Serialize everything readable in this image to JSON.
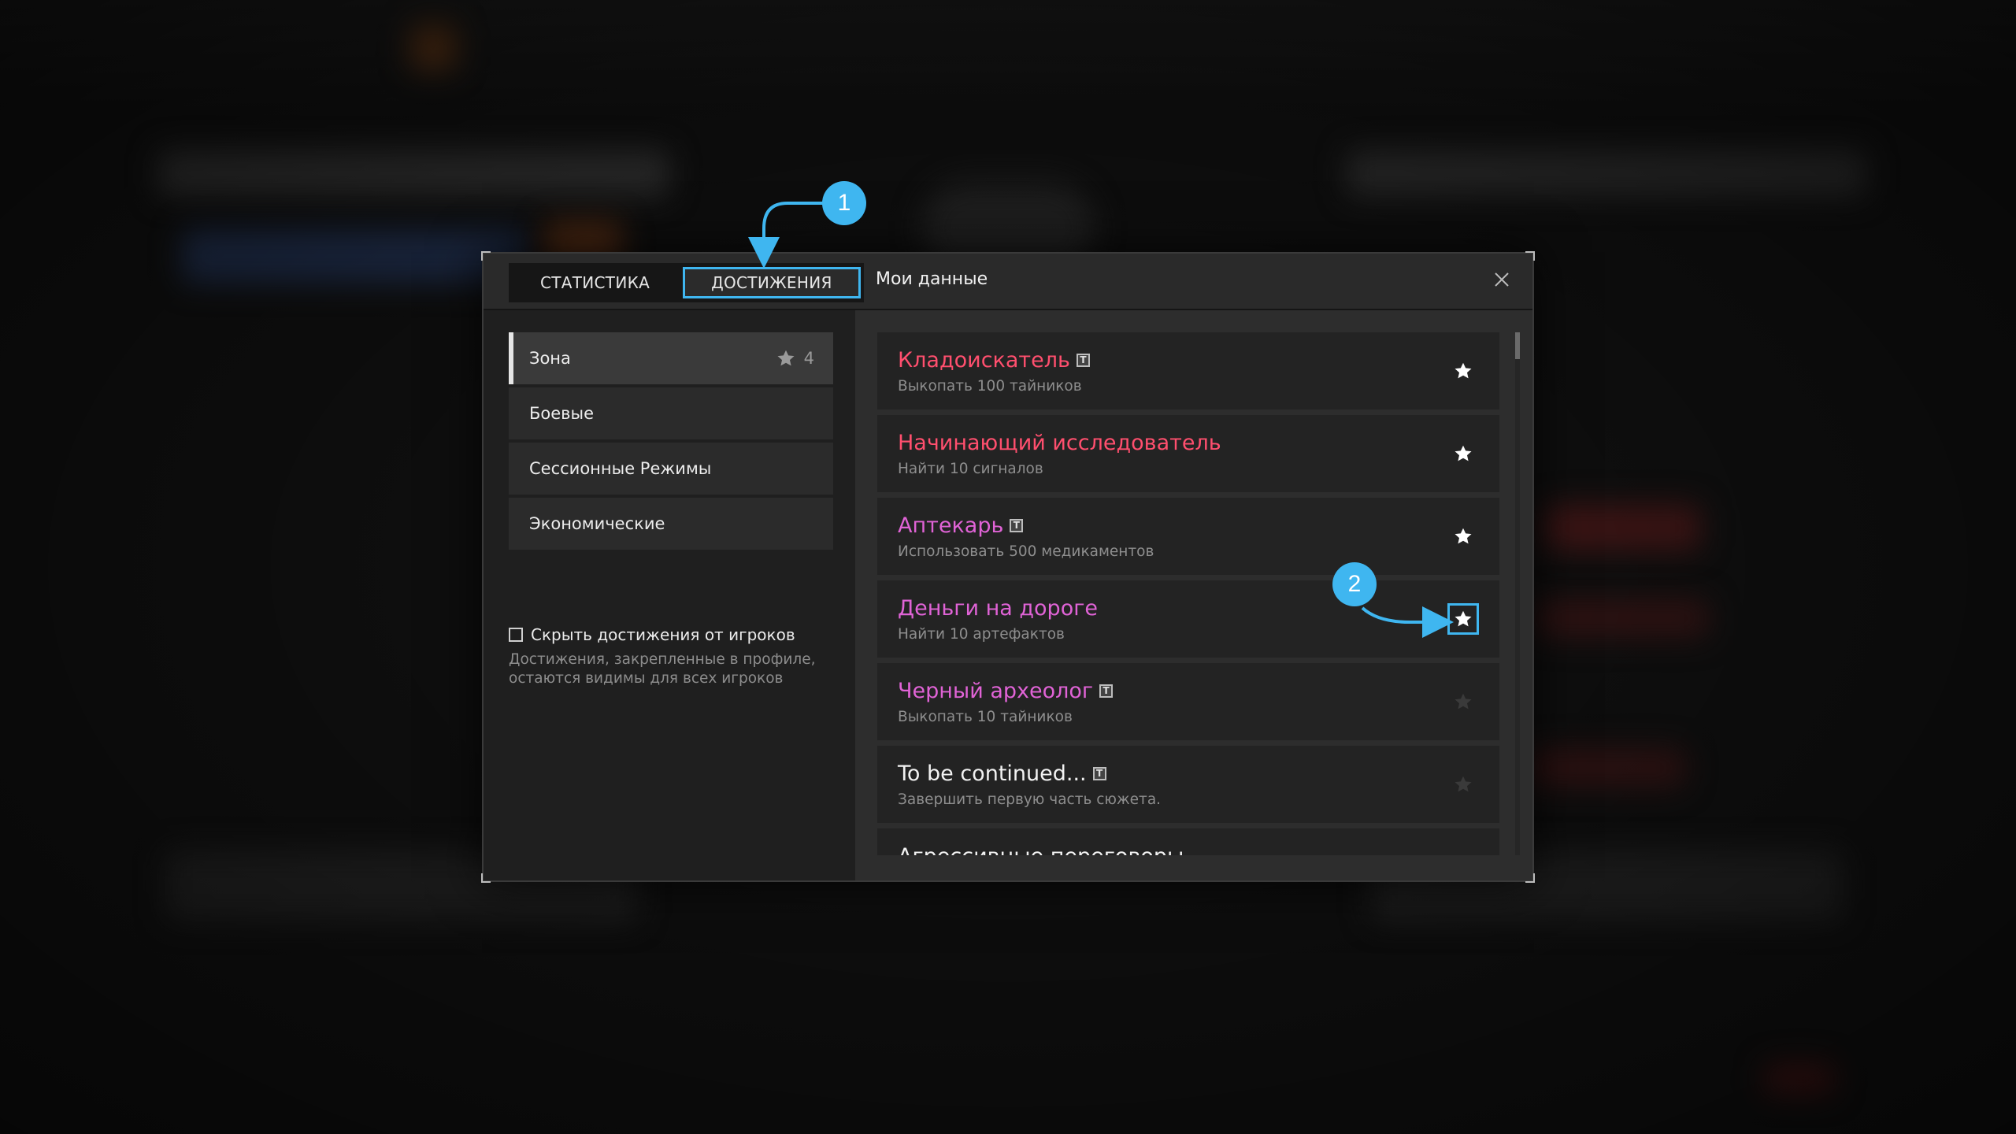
{
  "tabs": [
    {
      "label": "СТАТИСТИКА",
      "active": false
    },
    {
      "label": "ДОСТИЖЕНИЯ",
      "active": true
    }
  ],
  "section_title": "Мои данные",
  "categories": [
    {
      "label": "Зона",
      "count": "4",
      "active": true
    },
    {
      "label": "Боевые",
      "active": false
    },
    {
      "label": "Сессионные Режимы",
      "active": false
    },
    {
      "label": "Экономические",
      "active": false
    }
  ],
  "hide_option": {
    "label": "Скрыть достижения от игроков",
    "checked": false,
    "note": "Достижения, закрепленные в профиле, остаются видимы для всех игроков"
  },
  "achievements": [
    {
      "title": "Кладоискатель",
      "desc": "Выкопать 100 тайников",
      "badge": "T",
      "color": "#ff4f6e",
      "pinned": true
    },
    {
      "title": "Начинающий исследователь",
      "desc": "Найти 10 сигналов",
      "badge": "",
      "color": "#ff4f6e",
      "pinned": true
    },
    {
      "title": "Аптекарь",
      "desc": "Использовать 500 медикаментов",
      "badge": "T",
      "color": "#e063d6",
      "pinned": true
    },
    {
      "title": "Деньги на дороге",
      "desc": "Найти 10 артефактов",
      "badge": "",
      "color": "#e063d6",
      "pinned": true,
      "highlighted": true
    },
    {
      "title": "Черный археолог",
      "desc": "Выкопать 10 тайников",
      "badge": "T",
      "color": "#e063d6",
      "pinned": false
    },
    {
      "title": "To be continued...",
      "desc": "Завершить первую часть сюжета.",
      "badge": "T",
      "color": "#f2f2f2",
      "pinned": false
    },
    {
      "title": "Агрессивные переговоры",
      "desc": "",
      "badge": "",
      "color": "#f2f2f2",
      "pinned": false
    }
  ],
  "callouts": [
    "1",
    "2"
  ],
  "colors": {
    "accent": "#3fb6f0",
    "pinned_star": "#ffffff",
    "unpinned_star": "#3a3a3a"
  },
  "icons": {
    "close": "close-icon",
    "star": "star-icon",
    "checkbox": "checkbox-icon",
    "title_badge": "t-badge-icon"
  }
}
